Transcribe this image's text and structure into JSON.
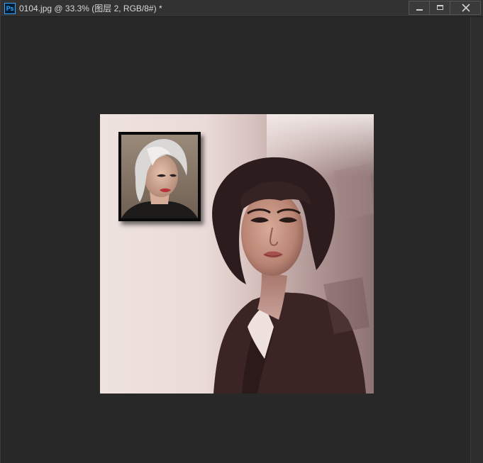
{
  "window": {
    "app_icon_label": "Ps",
    "title": "0104.jpg @ 33.3% (图层 2, RGB/8#) *",
    "controls": [
      "minimize",
      "maximize",
      "close"
    ]
  },
  "document": {
    "main_image": "portrait-painting-dark-bob-hair",
    "inset_image": "portrait-silver-hair-woman"
  },
  "icons": {
    "app": "photoshop-icon",
    "minimize": "minimize-icon",
    "maximize": "maximize-icon",
    "close": "close-icon"
  }
}
